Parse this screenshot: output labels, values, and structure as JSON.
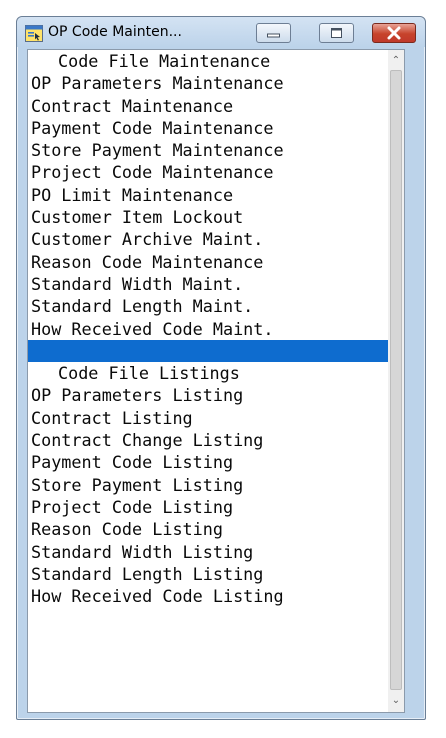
{
  "window": {
    "title": "OP Code Mainten..."
  },
  "menu": {
    "items": [
      {
        "label": "Code File Maintenance",
        "kind": "header"
      },
      {
        "label": "OP Parameters Maintenance",
        "kind": "item"
      },
      {
        "label": "Contract Maintenance",
        "kind": "item"
      },
      {
        "label": "Payment Code Maintenance",
        "kind": "item"
      },
      {
        "label": "Store Payment Maintenance",
        "kind": "item"
      },
      {
        "label": "Project Code Maintenance",
        "kind": "item"
      },
      {
        "label": "PO Limit Maintenance",
        "kind": "item"
      },
      {
        "label": "Customer Item Lockout",
        "kind": "item"
      },
      {
        "label": "Customer Archive Maint.",
        "kind": "item"
      },
      {
        "label": "Reason Code Maintenance",
        "kind": "item"
      },
      {
        "label": "Standard Width Maint.",
        "kind": "item"
      },
      {
        "label": "Standard Length Maint.",
        "kind": "item"
      },
      {
        "label": "How Received Code Maint.",
        "kind": "item"
      },
      {
        "label": "",
        "kind": "selected"
      },
      {
        "label": "Code File Listings",
        "kind": "header"
      },
      {
        "label": "OP Parameters Listing",
        "kind": "item"
      },
      {
        "label": "Contract Listing",
        "kind": "item"
      },
      {
        "label": "Contract Change Listing",
        "kind": "item"
      },
      {
        "label": "Payment Code Listing",
        "kind": "item"
      },
      {
        "label": "Store Payment Listing",
        "kind": "item"
      },
      {
        "label": "Project Code Listing",
        "kind": "item"
      },
      {
        "label": "Reason Code Listing",
        "kind": "item"
      },
      {
        "label": "Standard Width Listing",
        "kind": "item"
      },
      {
        "label": "Standard Length Listing",
        "kind": "item"
      },
      {
        "label": "How Received Code Listing",
        "kind": "item"
      }
    ]
  },
  "icons": {
    "app": "app-window-icon",
    "minimize": "minimize-icon",
    "maximize": "maximize-icon",
    "close": "close-icon",
    "scroll_up": "chevron-up-icon",
    "scroll_down": "chevron-down-icon"
  },
  "colors": {
    "selection": "#0e6ccf",
    "close_button": "#c7432b"
  }
}
